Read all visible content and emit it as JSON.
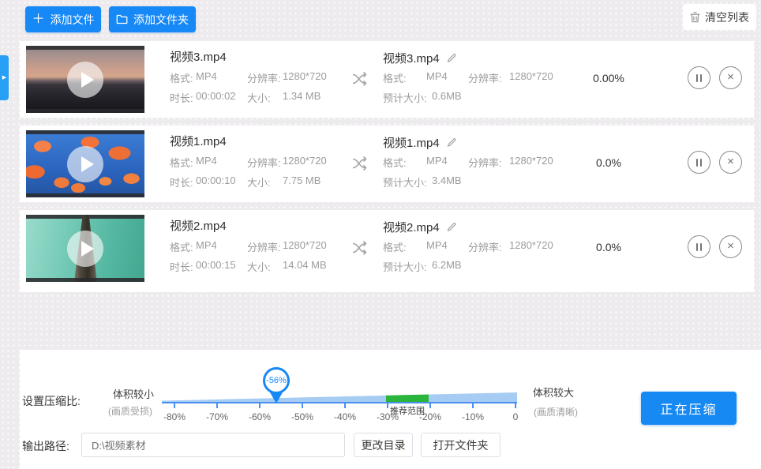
{
  "toolbar": {
    "add_file": "添加文件",
    "add_folder": "添加文件夹",
    "clear_list": "清空列表"
  },
  "labels": {
    "format": "格式:",
    "resolution": "分辨率:",
    "duration": "时长:",
    "size": "大小:",
    "estimated_size": "预计大小:"
  },
  "rows": [
    {
      "source": {
        "name": "视频3.mp4",
        "format": "MP4",
        "resolution": "1280*720",
        "duration": "00:00:02",
        "size": "1.34 MB"
      },
      "output": {
        "name": "视频3.mp4",
        "format": "MP4",
        "resolution": "1280*720",
        "estimated_size": "0.6MB"
      },
      "progress": "0.00%"
    },
    {
      "source": {
        "name": "视频1.mp4",
        "format": "MP4",
        "resolution": "1280*720",
        "duration": "00:00:10",
        "size": "7.75 MB"
      },
      "output": {
        "name": "视频1.mp4",
        "format": "MP4",
        "resolution": "1280*720",
        "estimated_size": "3.4MB"
      },
      "progress": "0.0%"
    },
    {
      "source": {
        "name": "视频2.mp4",
        "format": "MP4",
        "resolution": "1280*720",
        "duration": "00:00:15",
        "size": "14.04 MB"
      },
      "output": {
        "name": "视频2.mp4",
        "format": "MP4",
        "resolution": "1280*720",
        "estimated_size": "6.2MB"
      },
      "progress": "0.0%"
    }
  ],
  "compression": {
    "section_label": "设置压缩比:",
    "left_label": "体积较小",
    "left_sub": "(画质受损)",
    "right_label": "体积较大",
    "right_sub": "(画质清晰)",
    "value": "-56%",
    "recommended_label": "推荐范围",
    "ticks": [
      "-80%",
      "-70%",
      "-60%",
      "-50%",
      "-40%",
      "-30%",
      "-20%",
      "-10%",
      "0"
    ],
    "button": "正在压缩"
  },
  "output_path": {
    "label": "输出路径:",
    "value": "D:\\视频素材",
    "change_dir": "更改目录",
    "open_folder": "打开文件夹"
  },
  "icons": {
    "plus": "＋",
    "close": "×",
    "expand_arrow": "▶"
  },
  "colors": {
    "accent": "#1789f7",
    "slider_track": "#a7ccf4",
    "recommended_green": "#2cb53c"
  }
}
